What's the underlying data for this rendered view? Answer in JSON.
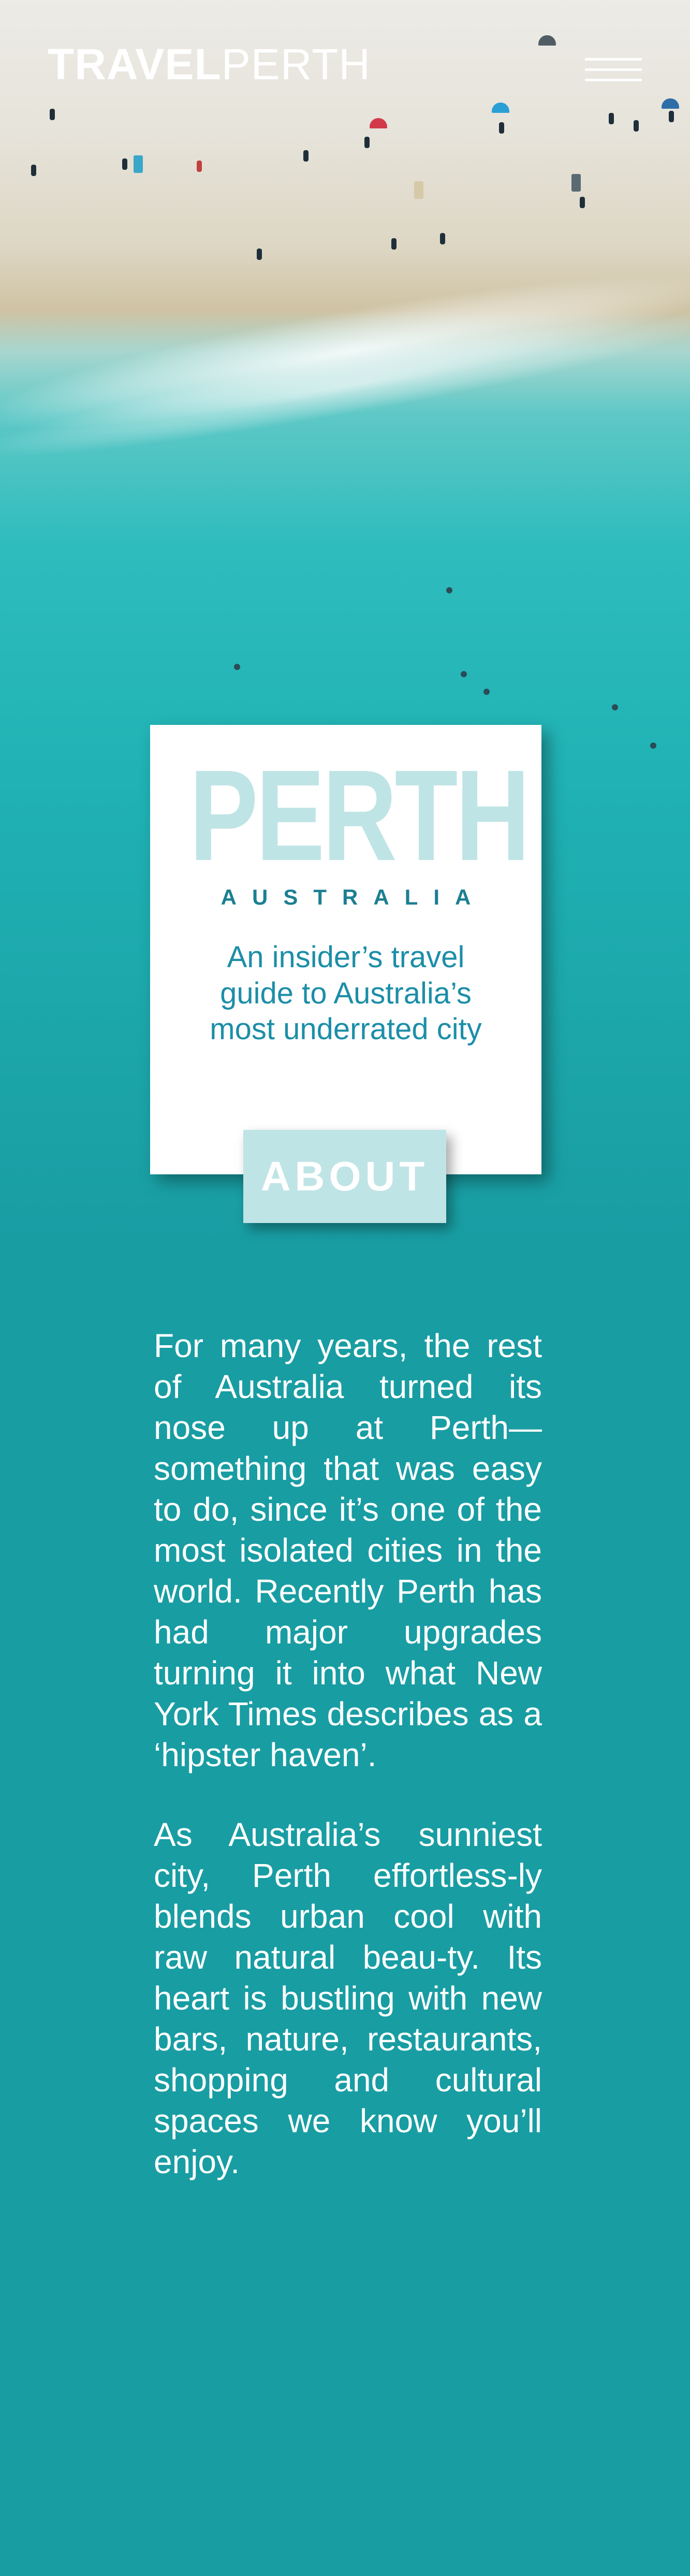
{
  "header": {
    "logo_bold": "TRAVEL",
    "logo_thin": "PERTH",
    "menu_icon": "hamburger-menu-icon"
  },
  "card": {
    "title": "PERTH",
    "subtitle": "AUSTRALIA",
    "tagline_lines": [
      "An insider’s travel",
      "guide to Australia’s",
      "most underrated city"
    ]
  },
  "about": {
    "button_label": "ABOUT"
  },
  "content": {
    "paragraphs": [
      "For many years, the rest of Australia turned its nose up at Perth—something that was easy to do, since it’s one of the most isolated cities in the world. Recently Perth has had major upgrades turning it into what New York Times describes as a ‘hipster haven’.",
      "As Australia’s sunniest city, Perth effortless-ly blends urban cool with raw natural beau-ty. Its heart is bustling with new bars, nature, restaurants, shopping and cultural spaces we know you’ll enjoy."
    ]
  },
  "colors": {
    "sea": "#189da3",
    "card_title": "#bfe4e6",
    "card_subtitle": "#1c7f93",
    "tagline": "#1c8ea8",
    "text": "#ffffff"
  }
}
